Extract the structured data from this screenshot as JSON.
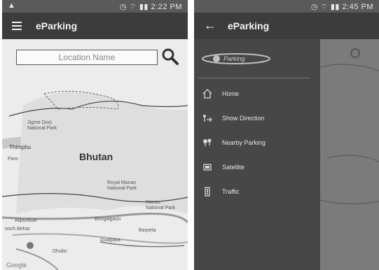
{
  "left_screen": {
    "status_time": "2:22 PM",
    "app_title": "eParking",
    "search": {
      "placeholder": "Location Name"
    },
    "map_labels": {
      "country": "Bhutan",
      "thimphu": "Thimphu",
      "paro": "Paro",
      "jigme": "Jigme Dorji",
      "jigme2": "National Park",
      "bongaigaon": "Bongaigaon",
      "alipurduar": "Alipurduar",
      "coochbehar": "ooch Behar",
      "barpeta": "Barpeta",
      "dhubri": "Dhubri",
      "goalpara": "Goalpara",
      "royal": "Royal Manas",
      "royal2": "National Park",
      "manas": "Manas",
      "manas2": "National Park",
      "google": "Google"
    }
  },
  "right_screen": {
    "status_time": "2:45 PM",
    "app_title": "eParking",
    "logo_text": "Parking",
    "menu": [
      {
        "label": "Home",
        "icon": "home-icon"
      },
      {
        "label": "Show Direction",
        "icon": "directions-icon"
      },
      {
        "label": "Nearby Parking",
        "icon": "nearby-pin-icon"
      },
      {
        "label": "Satellite",
        "icon": "satellite-icon"
      },
      {
        "label": "Traffic",
        "icon": "traffic-icon"
      }
    ]
  },
  "colors": {
    "appbar": "#3c3c3c",
    "statusbar": "#5a5a5a",
    "drawer": "#474747",
    "map": "#e9e9e9"
  }
}
